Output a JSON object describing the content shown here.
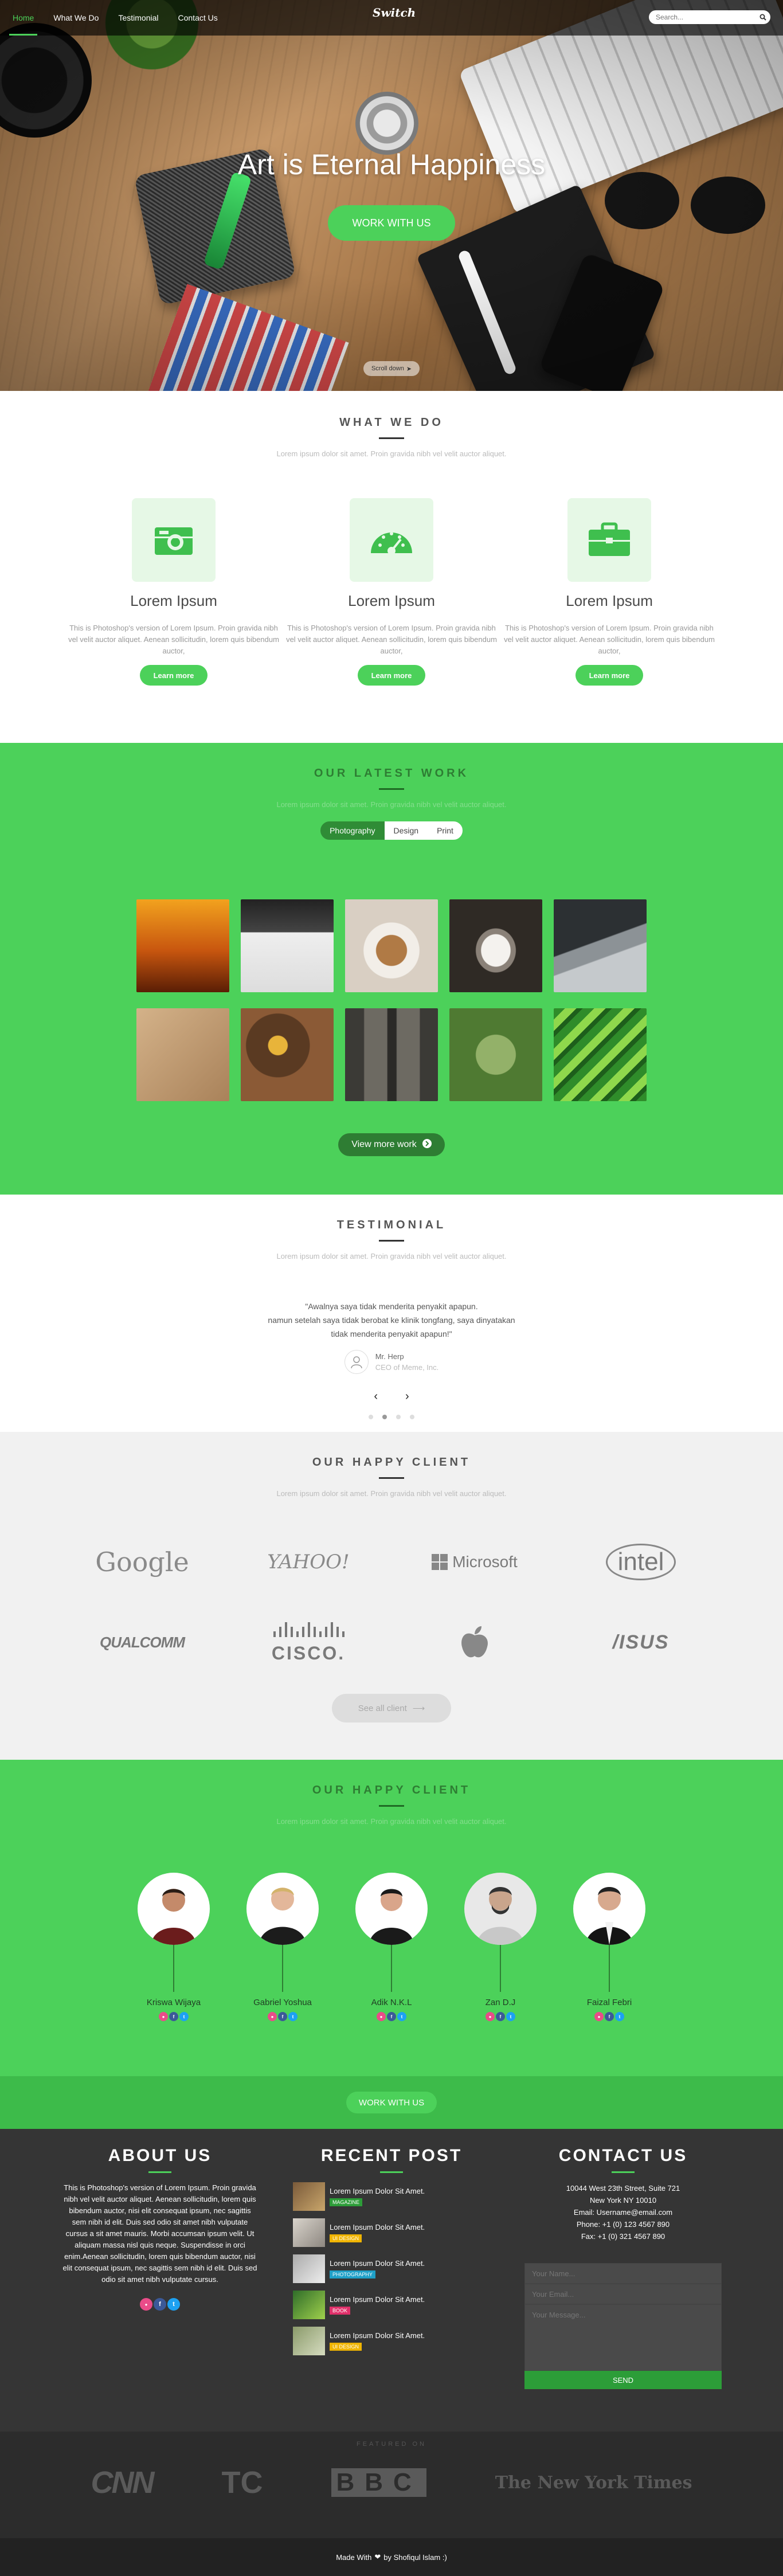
{
  "nav": {
    "brand": "Switch",
    "links": [
      {
        "label": "Home",
        "active": true
      },
      {
        "label": "What We Do",
        "active": false
      },
      {
        "label": "Testimonial",
        "active": false
      },
      {
        "label": "Contact Us",
        "active": false
      }
    ],
    "search_placeholder": "Search..."
  },
  "hero": {
    "title": "Art is Eternal Happiness",
    "cta": "WORK WITH US",
    "scroll_label": "Scroll down"
  },
  "what_we_do": {
    "title": "WHAT WE DO",
    "subtitle": "Lorem ipsum dolor sit amet. Proin gravida nibh vel velit auctor aliquet.",
    "services": [
      {
        "icon": "camera-icon",
        "title": "Lorem Ipsum",
        "text": "This is Photoshop's version of Lorem Ipsum. Proin gravida nibh vel velit auctor aliquet. Aenean sollicitudin, lorem quis bibendum auctor,",
        "button": "Learn more"
      },
      {
        "icon": "dashboard-icon",
        "title": "Lorem Ipsum",
        "text": "This is Photoshop's version of Lorem Ipsum. Proin gravida nibh vel velit auctor aliquet. Aenean sollicitudin, lorem quis bibendum auctor,",
        "button": "Learn more"
      },
      {
        "icon": "briefcase-icon",
        "title": "Lorem Ipsum",
        "text": "This is Photoshop's version of Lorem Ipsum. Proin gravida nibh vel velit auctor aliquet. Aenean sollicitudin, lorem quis bibendum auctor,",
        "button": "Learn more"
      }
    ]
  },
  "latest_work": {
    "title": "OUR LATEST WORK",
    "subtitle": "Lorem ipsum dolor sit amet. Proin gravida nibh vel velit auctor aliquet.",
    "filters": [
      "Photography",
      "Design",
      "Print"
    ],
    "more_button": "View more work",
    "thumbs": [
      {
        "name": "palm-trees-sunset-photo",
        "bg": "linear-gradient(180deg,#f2a21e,#c8560f 55%,#5a1e05)"
      },
      {
        "name": "desk-camera-photo",
        "bg": "linear-gradient(180deg,#222 0%,#444 35%,#eee 36%,#ddd 100%)"
      },
      {
        "name": "cake-coffee-photo",
        "bg": "radial-gradient(circle at 50% 55%,#b07a45 0 22%,#f2eee8 23% 40%,#d9cfc3 41%)"
      },
      {
        "name": "kitten-photo",
        "bg": "radial-gradient(ellipse at 50% 55%,#f4f2ee 0 22%,#8a8178 23% 30%,#2f2a25 31%)"
      },
      {
        "name": "laptop-code-photo",
        "bg": "linear-gradient(160deg,#2c3033 0 45%,#8c9296 46% 60%,#c5c9cc 61%)"
      },
      {
        "name": "workspace-flatlay-photo",
        "bg": "linear-gradient(135deg,#d4b289,#a9825a)"
      },
      {
        "name": "coffee-table-photo",
        "bg": "radial-gradient(circle at 40% 40%,#e8b43a 0 12%,#5a3a22 13% 40%,#8b5a36 41%)"
      },
      {
        "name": "rail-tracks-photo",
        "bg": "linear-gradient(90deg,#3b3a36 0 20%,#6d6a62 21% 45%,#2b2a27 46% 55%,#6d6a62 56% 80%,#3b3a36 81%)"
      },
      {
        "name": "green-ladybug-photo",
        "bg": "radial-gradient(circle at 50% 50%,#93b169 0 30%,#4f7a32 31%)"
      },
      {
        "name": "green-abstract-photo",
        "bg": "repeating-linear-gradient(135deg,#2f8c2a 0 14px,#8fd84c 14px 28px,#1d5e1b 28px 36px)"
      }
    ]
  },
  "testimonial": {
    "title": "TESTIMONIAL",
    "subtitle": "Lorem ipsum dolor sit amet. Proin gravida nibh vel velit auctor aliquet.",
    "quote_1": "\"Awalnya saya tidak menderita penyakit apapun.",
    "quote_2": "namun setelah saya tidak berobat ke klinik tongfang, saya dinyatakan",
    "quote_3": "tidak menderita penyakit apapun!\"",
    "author": "Mr. Herp",
    "role": "CEO of Meme, Inc."
  },
  "clients": {
    "title": "OUR HAPPY CLIENT",
    "subtitle": "Lorem ipsum dolor sit amet. Proin gravida nibh vel velit auctor aliquet.",
    "logos": [
      "Google",
      "YAHOO!",
      "Microsoft",
      "intel",
      "QUALCOMM",
      "CISCO.",
      "",
      "/ISUS"
    ],
    "see_all": "See all client"
  },
  "team": {
    "title": "OUR HAPPY CLIENT",
    "subtitle": "Lorem ipsum dolor sit amet. Proin gravida nibh vel velit auctor aliquet.",
    "members": [
      {
        "name": "Kriswa Wijaya"
      },
      {
        "name": "Gabriel Yoshua"
      },
      {
        "name": "Adik N.K.L"
      },
      {
        "name": "Zan D.J"
      },
      {
        "name": "Faizal Febri"
      }
    ],
    "cta": "WORK WITH US"
  },
  "footer": {
    "about_title": "ABOUT US",
    "about_text": "This is Photoshop's version of Lorem Ipsum. Proin gravida nibh vel velit auctor aliquet. Aenean sollicitudin, lorem quis bibendum auctor, nisi elit consequat ipsum, nec sagittis sem nibh id elit. Duis sed odio sit amet nibh vulputate cursus a sit amet mauris. Morbi accumsan ipsum velit. Ut aliquam massa nisl quis neque. Suspendisse in orci enim.Aenean sollicitudin, lorem quis bibendum auctor, nisi elit consequat ipsum, nec sagittis sem nibh id elit. Duis sed odio sit amet nibh vulputate cursus.",
    "posts_title": "RECENT POST",
    "posts": [
      {
        "title": "Lorem Ipsum Dolor Sit Amet.",
        "tag": "MAGAZINE",
        "color": "#2c9d38",
        "thumb": "linear-gradient(135deg,#7a5a3a,#c9a66b)"
      },
      {
        "title": "Lorem Ipsum Dolor Sit Amet.",
        "tag": "UI DESIGN",
        "color": "#f0b400",
        "thumb": "linear-gradient(135deg,#d9d4cc,#8d8780)"
      },
      {
        "title": "Lorem Ipsum Dolor Sit Amet.",
        "tag": "PHOTOGRAPHY",
        "color": "#1fa0c8",
        "thumb": "linear-gradient(135deg,#aaa,#eee)"
      },
      {
        "title": "Lorem Ipsum Dolor Sit Amet.",
        "tag": "BOOK",
        "color": "#e0306a",
        "thumb": "linear-gradient(135deg,#2f6d2a,#9fd04c)"
      },
      {
        "title": "Lorem Ipsum Dolor Sit Amet.",
        "tag": "UI DESIGN",
        "color": "#f0b400",
        "thumb": "linear-gradient(135deg,#8a9a6a,#d6dcc0)"
      }
    ],
    "contact_title": "CONTACT US",
    "address_1": "10044 West 23th Street, Suite 721",
    "address_2": "New York NY 10010",
    "email": "Email: Username@email.com",
    "phone": "Phone: +1 (0) 123 4567 890",
    "fax": "Fax: +1 (0) 321 4567 890",
    "name_placeholder": "Your Name...",
    "email_placeholder": "Your Email...",
    "message_placeholder": "Your Message...",
    "send": "SEND"
  },
  "press": {
    "title": "FEATURED ON",
    "logos": [
      "CNN",
      "TC",
      "BBC",
      "The New York Times"
    ]
  },
  "bottom": {
    "made_prefix": "Made With",
    "made_suffix": "by Shofiqul Islam :)"
  }
}
